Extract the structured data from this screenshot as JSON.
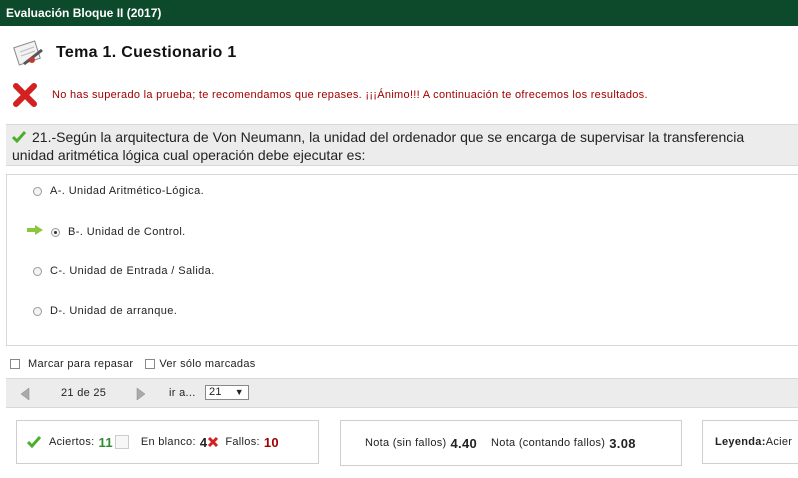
{
  "window": {
    "title": "Evaluación Bloque II (2017)"
  },
  "header": {
    "title": "Tema 1. Cuestionario 1",
    "icon": "notepad-pencil-icon"
  },
  "result_message": {
    "text": "No has superado la prueba; te recomendamos que repases. ¡¡¡Ánimo!!! A continuación te ofrecemos los resultados.",
    "icon": "red-cross-icon",
    "color": "#a00000"
  },
  "question": {
    "line1": "21.-Según la arquitectura de Von Neumann, la unidad del ordenador que se encarga de supervisar la transferencia",
    "line2": "unidad aritmética lógica cual operación debe ejecutar es:",
    "icon": "green-check-icon"
  },
  "options": [
    {
      "label": "A-. Unidad Aritmético-Lógica.",
      "selected": false,
      "correct_arrow": false
    },
    {
      "label": "B-. Unidad de Control.",
      "selected": true,
      "correct_arrow": true
    },
    {
      "label": "C-. Unidad de Entrada / Salida.",
      "selected": false,
      "correct_arrow": false
    },
    {
      "label": "D-. Unidad de arranque.",
      "selected": false,
      "correct_arrow": false
    }
  ],
  "marks": {
    "mark_review": "Marcar para repasar",
    "show_marked": "Ver sólo marcadas"
  },
  "nav": {
    "position": "21 de 25",
    "goto_label": "ir a...",
    "goto_value": "21"
  },
  "stats": {
    "aciertos_label": "Aciertos:",
    "aciertos": "11",
    "blanco_label": "En blanco:",
    "blanco": "4",
    "fallos_label": "Fallos:",
    "fallos": "10"
  },
  "grades": {
    "sin_fallos_label": "Nota (sin fallos)",
    "sin_fallos": "4.40",
    "contando_label": "Nota (contando fallos)",
    "contando": "3.08"
  },
  "legend": {
    "label": "Leyenda:",
    "text": "Acier"
  },
  "colors": {
    "titlebar": "#0d4a2b",
    "error": "#a00000",
    "success": "#2e8b2e",
    "arrow": "#8cc63f"
  }
}
